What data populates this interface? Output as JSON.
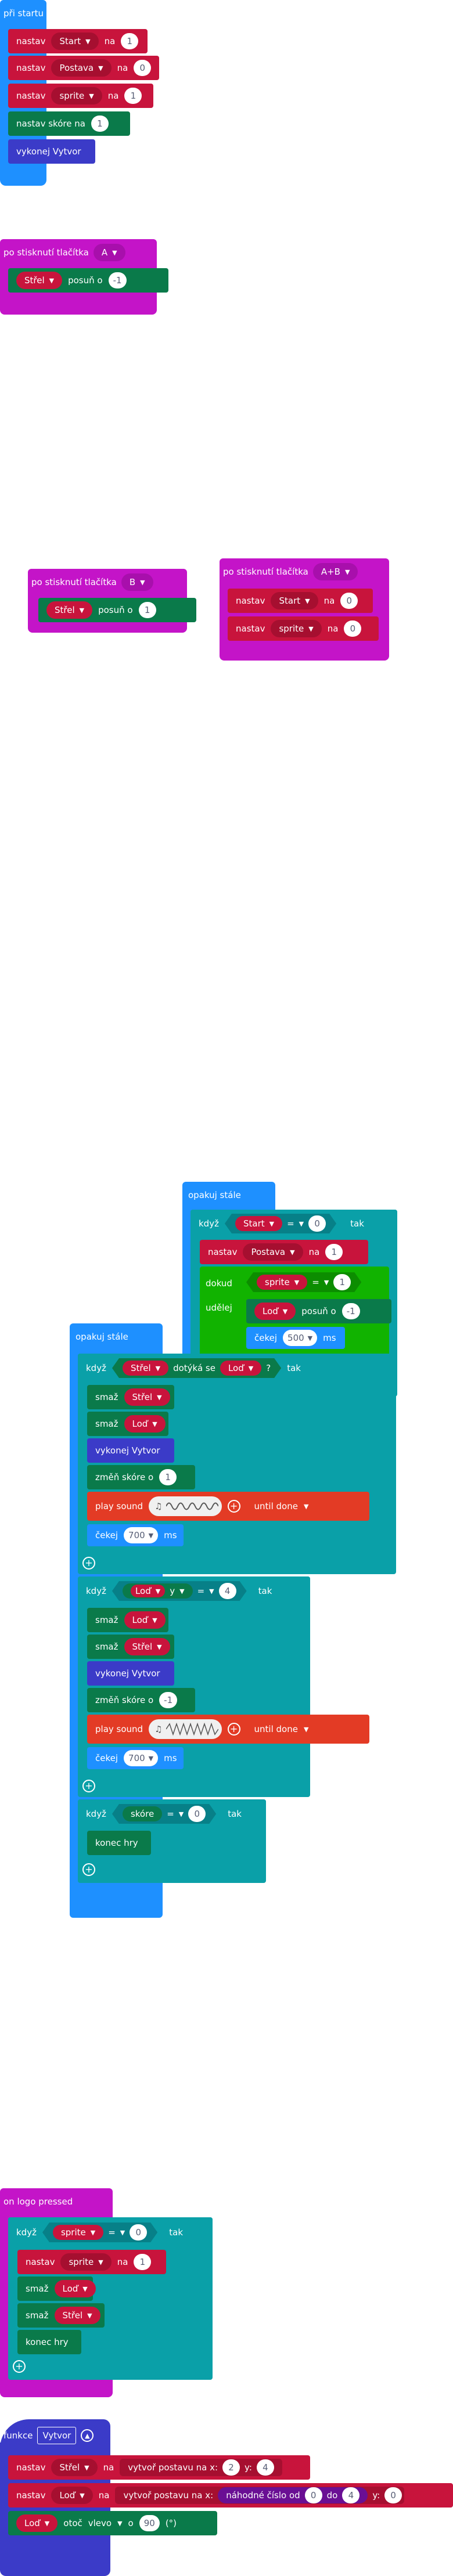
{
  "colors": {
    "loops": "#1e90ff",
    "sprite": "#c8143c",
    "input": "#c414c8",
    "logic": "#0aa0a8",
    "game": "#0a7a4a",
    "func": "#3b3bc8",
    "music": "#e33b25"
  },
  "on_start": {
    "hat": "při startu",
    "r1": {
      "pre": "nastav",
      "var": "Start",
      "mid": "na",
      "val": "1"
    },
    "r2": {
      "pre": "nastav",
      "var": "Postava",
      "mid": "na",
      "val": "0"
    },
    "r3": {
      "pre": "nastav",
      "var": "sprite",
      "mid": "na",
      "val": "1"
    },
    "r4": {
      "text": "nastav skóre na",
      "val": "1"
    },
    "r5": "vykonej Vytvor"
  },
  "btn_a": {
    "hat": "po stisknutí tlačítka",
    "btn": "A",
    "sprite": "Střel",
    "action": "posuň o",
    "val": "-1"
  },
  "btn_b": {
    "hat": "po stisknutí tlačítka",
    "btn": "B",
    "sprite": "Střel",
    "action": "posuň o",
    "val": "1"
  },
  "btn_ab": {
    "hat": "po stisknutí tlačítka",
    "btn": "A+B",
    "r1": {
      "pre": "nastav",
      "var": "Start",
      "mid": "na",
      "val": "0"
    },
    "r2": {
      "pre": "nastav",
      "var": "sprite",
      "mid": "na",
      "val": "0"
    }
  },
  "forever1": {
    "hat": "opakuj stále",
    "if": "když",
    "var": "Start",
    "op": "=",
    "val": "0",
    "then": "tak",
    "set": {
      "pre": "nastav",
      "var": "Postava",
      "mid": "na",
      "val": "1"
    },
    "while": "dokud",
    "do": "udělej",
    "cond_var": "sprite",
    "cond_op": "=",
    "cond_val": "1",
    "move": {
      "sprite": "Loď",
      "action": "posuň o",
      "val": "-1"
    },
    "wait": {
      "pre": "čekej",
      "val": "500",
      "unit": "ms"
    }
  },
  "forever2": {
    "hat": "opakuj stále",
    "if1": {
      "kdyz": "když",
      "a": "Střel",
      "touch": "dotýká se",
      "b": "Loď",
      "q": "?",
      "tak": "tak",
      "del1": {
        "pre": "smaž",
        "var": "Střel"
      },
      "del2": {
        "pre": "smaž",
        "var": "Loď"
      },
      "call": "vykonej Vytvor",
      "score": {
        "text": "změň skóre o",
        "val": "1"
      },
      "sound": {
        "pre": "play sound",
        "post": "until done"
      },
      "wait": {
        "pre": "čekej",
        "val": "700",
        "unit": "ms"
      }
    },
    "if2": {
      "kdyz": "když",
      "a": "Loď",
      "prop": "y",
      "op": "=",
      "val": "4",
      "tak": "tak",
      "del1": {
        "pre": "smaž",
        "var": "Loď"
      },
      "del2": {
        "pre": "smaž",
        "var": "Střel"
      },
      "call": "vykonej Vytvor",
      "score": {
        "text": "změň skóre o",
        "val": "-1"
      },
      "sound": {
        "pre": "play sound",
        "post": "until done"
      },
      "wait": {
        "pre": "čekej",
        "val": "700",
        "unit": "ms"
      }
    },
    "if3": {
      "kdyz": "když",
      "a": "skóre",
      "op": "=",
      "val": "0",
      "tak": "tak",
      "end": "konec hry"
    }
  },
  "logo": {
    "hat": "on logo pressed",
    "kdyz": "když",
    "var": "sprite",
    "op": "=",
    "val": "0",
    "tak": "tak",
    "set": {
      "pre": "nastav",
      "var": "sprite",
      "mid": "na",
      "val": "1"
    },
    "del1": {
      "pre": "smaž",
      "var": "Loď"
    },
    "del2": {
      "pre": "smaž",
      "var": "Střel"
    },
    "end": "konec hry"
  },
  "func": {
    "hat": "funkce",
    "name": "Vytvor",
    "r1": {
      "pre": "nastav",
      "var": "Střel",
      "mid": "na",
      "create": "vytvoř postavu na x:",
      "x": "2",
      "ylab": "y:",
      "y": "4"
    },
    "r2": {
      "pre": "nastav",
      "var": "Loď",
      "mid": "na",
      "create": "vytvoř postavu na x:",
      "rand": "náhodné číslo od",
      "from": "0",
      "to": "do",
      "toval": "4",
      "ylab": "y:",
      "y": "0"
    },
    "r3": {
      "sprite": "Loď",
      "act": "otoč",
      "dir": "vlevo",
      "o": "o",
      "deg": "90",
      "unit": "(°)"
    }
  }
}
